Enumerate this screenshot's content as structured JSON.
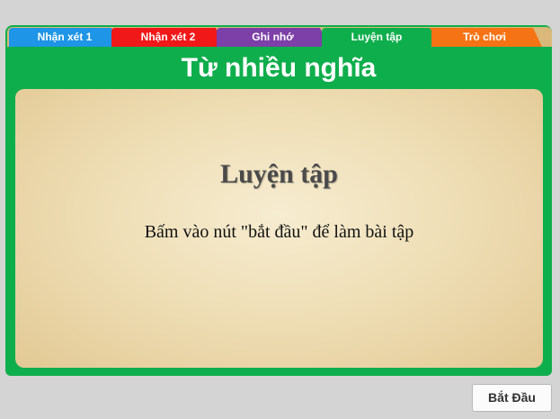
{
  "tabs": [
    {
      "label": "Nhận xét 1",
      "color": "#1e95e6"
    },
    {
      "label": "Nhận xét 2",
      "color": "#f01818"
    },
    {
      "label": "Ghi nhớ",
      "color": "#7d3fa8"
    },
    {
      "label": "Luyện tập",
      "color": "#0fae4c",
      "active": true
    },
    {
      "label": "Trò chơi",
      "color": "#f57314"
    }
  ],
  "lesson": {
    "title": "Từ nhiều nghĩa"
  },
  "card": {
    "heading": "Luyện tập",
    "instruction": "Bấm vào nút \"bắt đầu\" để làm bài tập"
  },
  "footer": {
    "start_label": "Bắt Đầu"
  },
  "colors": {
    "frame": "#0fae4c",
    "background": "#d4d4d4"
  }
}
